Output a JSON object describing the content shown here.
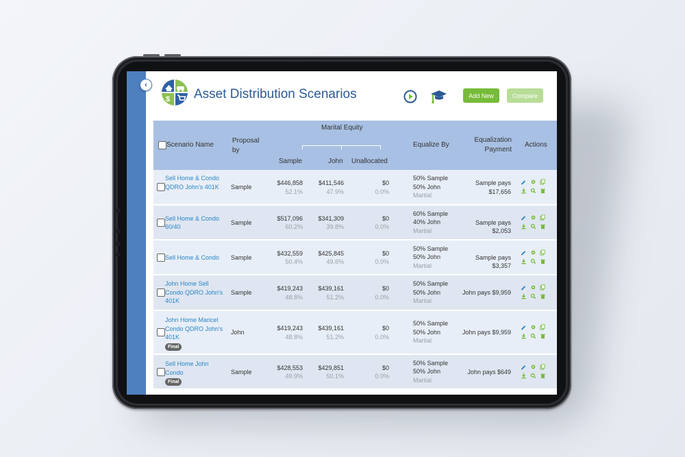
{
  "app": {
    "title": "Asset Distribution Scenarios",
    "buttons": {
      "add_new": "Add New",
      "compare": "Compare"
    },
    "colors": {
      "accent_blue": "#2c5a96",
      "green": "#77bb3a",
      "link": "#2a86c6",
      "sidebar": "#4e7fbf"
    }
  },
  "table": {
    "headers": {
      "scenario_name": "Scenario Name",
      "proposal_by": "Proposal by",
      "marital_equity": "Marital Equity",
      "sample": "Sample",
      "john": "John",
      "unallocated": "Unallocated",
      "equalize_by": "Equalize By",
      "equalization_payment": "Equalization Payment",
      "actions": "Actions"
    },
    "rows": [
      {
        "name": "Sell Home & Condo QDRO John's 401K",
        "final": "",
        "proposal": "Sample",
        "sample_amt": "$446,858",
        "sample_pct": "52.1%",
        "john_amt": "$411,546",
        "john_pct": "47.9%",
        "unalloc_amt": "$0",
        "unalloc_pct": "0.0%",
        "eq1": "50% Sample",
        "eq2": "50% John",
        "eq3": "Martial",
        "pay": "Sample pays $17,656"
      },
      {
        "name": "Sell Home & Condo 60/40",
        "final": "",
        "proposal": "Sample",
        "sample_amt": "$517,096",
        "sample_pct": "60.2%",
        "john_amt": "$341,309",
        "john_pct": "39.8%",
        "unalloc_amt": "$0",
        "unalloc_pct": "0.0%",
        "eq1": "60% Sample",
        "eq2": "40% John",
        "eq3": "Martial",
        "pay": "Sample pays $2,053"
      },
      {
        "name": "Sell Home & Condo",
        "final": "",
        "proposal": "Sample",
        "sample_amt": "$432,559",
        "sample_pct": "50.4%",
        "john_amt": "$425,845",
        "john_pct": "49.6%",
        "unalloc_amt": "$0",
        "unalloc_pct": "0.0%",
        "eq1": "50% Sample",
        "eq2": "50% John",
        "eq3": "Martial",
        "pay": "Sample pays $3,357"
      },
      {
        "name": "John Home Sell Condo QDRO John's 401K",
        "final": "",
        "proposal": "Sample",
        "sample_amt": "$419,243",
        "sample_pct": "48.8%",
        "john_amt": "$439,161",
        "john_pct": "51.2%",
        "unalloc_amt": "$0",
        "unalloc_pct": "0.0%",
        "eq1": "50% Sample",
        "eq2": "50% John",
        "eq3": "Martial",
        "pay": "John pays $9,959"
      },
      {
        "name": "John Home Maricel Condo QDRO John's 401K",
        "final": "Final",
        "proposal": "John",
        "sample_amt": "$419,243",
        "sample_pct": "48.8%",
        "john_amt": "$439,161",
        "john_pct": "51.2%",
        "unalloc_amt": "$0",
        "unalloc_pct": "0.0%",
        "eq1": "50% Sample",
        "eq2": "50% John",
        "eq3": "Martial",
        "pay": "John pays $9,959"
      },
      {
        "name": "Sell Home John Condo",
        "final": "Final",
        "proposal": "Sample",
        "sample_amt": "$428,553",
        "sample_pct": "49.9%",
        "john_amt": "$429,851",
        "john_pct": "50.1%",
        "unalloc_amt": "$0",
        "unalloc_pct": "0.0%",
        "eq1": "50% Sample",
        "eq2": "50% John",
        "eq3": "Martial",
        "pay": "John pays $649"
      }
    ]
  },
  "icons": [
    "chevron-left-icon",
    "play-icon",
    "graduation-cap-icon",
    "pencil-icon",
    "gear-icon",
    "copy-icon",
    "download-icon",
    "search-icon",
    "trash-icon"
  ]
}
